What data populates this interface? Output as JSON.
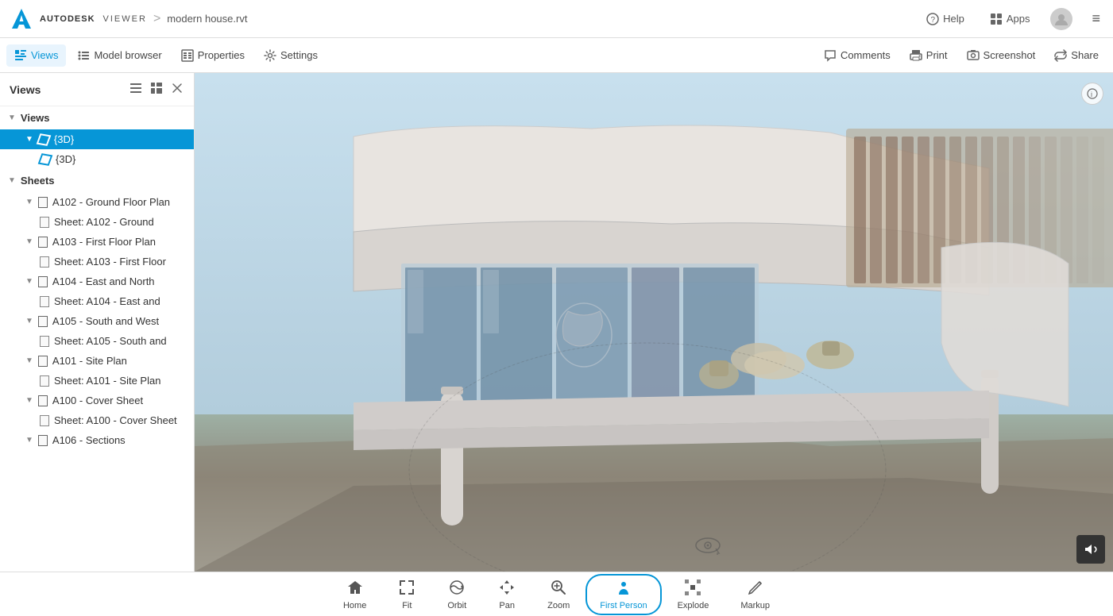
{
  "app": {
    "logo_text": "AUTODESK",
    "viewer_text": "VIEWER",
    "breadcrumb_sep": ">",
    "file_name": "modern house.rvt"
  },
  "top_bar": {
    "help_label": "Help",
    "apps_label": "Apps",
    "hamburger_icon": "≡"
  },
  "toolbar": {
    "views_label": "Views",
    "model_browser_label": "Model browser",
    "properties_label": "Properties",
    "settings_label": "Settings",
    "comments_label": "Comments",
    "print_label": "Print",
    "screenshot_label": "Screenshot",
    "share_label": "Share"
  },
  "sidebar": {
    "title": "Views",
    "views_section": "Views",
    "view_3d_parent": "{3D}",
    "view_3d_child": "{3D}",
    "sheets_section": "Sheets",
    "sheets": [
      {
        "id": "A102",
        "label": "A102 - Ground Floor Plan",
        "sub": "Sheet: A102 - Ground"
      },
      {
        "id": "A103",
        "label": "A103 - First Floor Plan",
        "sub": "Sheet: A103 - First Floor"
      },
      {
        "id": "A104",
        "label": "A104 - East and North",
        "sub": "Sheet: A104 - East and"
      },
      {
        "id": "A105",
        "label": "A105 - South and West",
        "sub": "Sheet: A105 - South and"
      },
      {
        "id": "A101",
        "label": "A101 - Site Plan",
        "sub": "Sheet: A101 - Site Plan"
      },
      {
        "id": "A100",
        "label": "A100 - Cover Sheet",
        "sub": "Sheet: A100 - Cover Sheet"
      },
      {
        "id": "A106",
        "label": "A106 - Sections",
        "sub": ""
      }
    ]
  },
  "bottom_toolbar": {
    "home_label": "Home",
    "fit_label": "Fit",
    "orbit_label": "Orbit",
    "pan_label": "Pan",
    "zoom_label": "Zoom",
    "first_person_label": "First Person",
    "explode_label": "Explode",
    "markup_label": "Markup"
  },
  "colors": {
    "accent": "#0696d7",
    "active_bg": "#0696d7",
    "toolbar_bg": "#ffffff"
  }
}
